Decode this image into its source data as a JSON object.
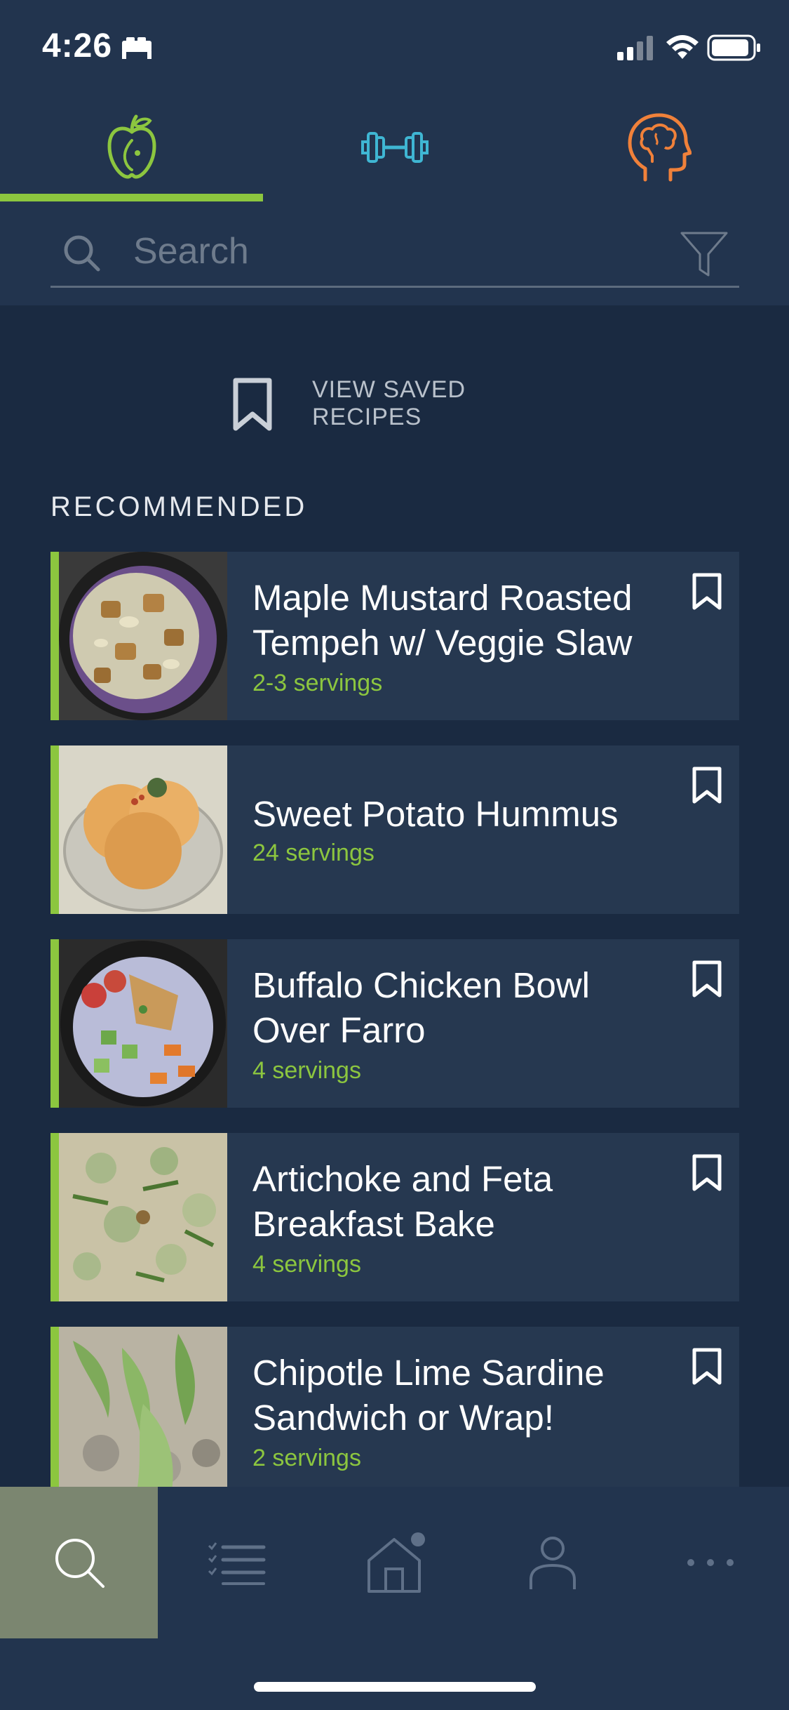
{
  "status_bar": {
    "time": "4:26",
    "icons": [
      "bed-icon",
      "signal-icon",
      "wifi-icon",
      "battery-icon"
    ]
  },
  "category_tabs": [
    {
      "name": "nutrition",
      "icon": "apple-icon",
      "active": true,
      "color": "#8cc63f"
    },
    {
      "name": "fitness",
      "icon": "dumbbell-icon",
      "active": false,
      "color": "#3fb6d3"
    },
    {
      "name": "mind",
      "icon": "head-brain-icon",
      "active": false,
      "color": "#f0813a"
    }
  ],
  "search": {
    "placeholder": "Search",
    "value": "",
    "icon": "search-icon",
    "filter_icon": "filter-icon"
  },
  "saved_recipes": {
    "label": "VIEW SAVED RECIPES",
    "icon": "bookmark-icon"
  },
  "section_heading": "RECOMMENDED",
  "recipes": [
    {
      "title_line1": "Maple Mustard Roasted",
      "title_line2": "Tempeh w/ Veggie Slaw",
      "servings": "2-3 servings"
    },
    {
      "title_line1": "Sweet Potato Hummus",
      "title_line2": "",
      "servings": "24 servings"
    },
    {
      "title_line1": "Buffalo Chicken Bowl",
      "title_line2": "Over Farro",
      "servings": "4 servings"
    },
    {
      "title_line1": "Artichoke and Feta",
      "title_line2": "Breakfast Bake",
      "servings": "4 servings"
    },
    {
      "title_line1": "Chipotle Lime Sardine",
      "title_line2": "Sandwich or Wrap!",
      "servings": "2 servings"
    }
  ],
  "bottom_nav": [
    {
      "name": "search",
      "icon": "search-icon",
      "active": true
    },
    {
      "name": "list",
      "icon": "checklist-icon",
      "active": false
    },
    {
      "name": "home",
      "icon": "home-icon",
      "active": false,
      "badge": true
    },
    {
      "name": "profile",
      "icon": "person-icon",
      "active": false
    },
    {
      "name": "more",
      "icon": "more-icon",
      "active": false
    }
  ],
  "colors": {
    "background": "#1a2a41",
    "header": "#22344e",
    "card": "#263850",
    "accent_green": "#8cc63f",
    "accent_blue": "#3fb6d3",
    "accent_orange": "#f0813a",
    "nav_active": "#7b8670"
  }
}
